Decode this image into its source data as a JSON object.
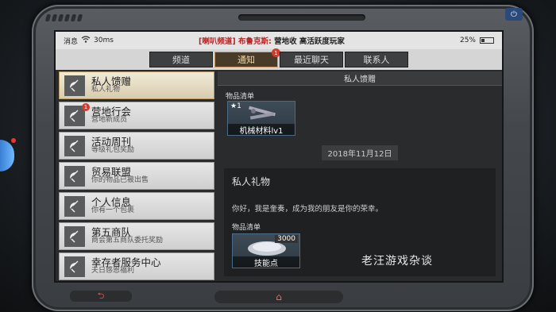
{
  "statusbar": {
    "signal_label": "消息",
    "ping": "30ms",
    "ticker_prefix": "[喇叭频道] 布鲁克斯:",
    "ticker": "营地收 高活跃度玩家",
    "battery": "25%"
  },
  "tabs": [
    {
      "label": "频道",
      "active": false
    },
    {
      "label": "通知",
      "active": true,
      "badge": "1"
    },
    {
      "label": "最近聊天",
      "active": false
    },
    {
      "label": "联系人",
      "active": false
    }
  ],
  "sidebar": {
    "items": [
      {
        "title": "私人馈赠",
        "subtitle": "私人礼物",
        "active": true
      },
      {
        "title": "营地行会",
        "subtitle": "营地新成员",
        "badge": "1"
      },
      {
        "title": "活动周刊",
        "subtitle": "等级礼包奖励"
      },
      {
        "title": "贸易联盟",
        "subtitle": "你的物品已被出售"
      },
      {
        "title": "个人信息",
        "subtitle": "你有一个包裹"
      },
      {
        "title": "第五商队",
        "subtitle": "商会第五商队委托奖励"
      },
      {
        "title": "幸存者服务中心",
        "subtitle": "夫日感恩福利"
      }
    ]
  },
  "content": {
    "header": "私人馈赠",
    "items_label": "物品清单",
    "item1": {
      "count": "★1",
      "name": "机械材料lv1"
    },
    "date": "2018年11月12日",
    "letter": {
      "title": "私人礼物",
      "body": "你好，我是奎奏，成为我的朋友是你的荣幸。",
      "items_label": "物品清单",
      "item": {
        "qty": "3000",
        "name": "技能点"
      }
    }
  },
  "watermark": "老汪游戏杂谈",
  "colors": {
    "accent": "#c9a06a",
    "badge": "#d43a2b"
  }
}
